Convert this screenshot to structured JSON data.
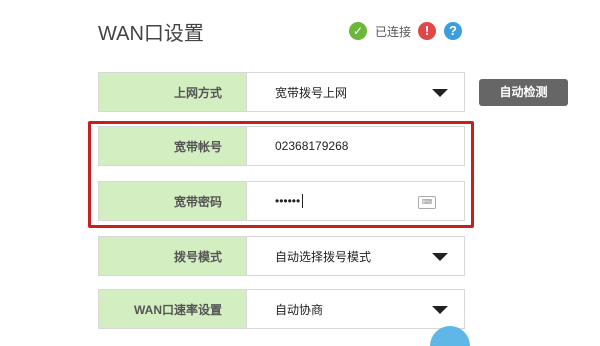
{
  "header": {
    "title": "WAN口设置",
    "status_text": "已连接",
    "status_icon": "check-icon",
    "warning_icon": "exclamation-icon",
    "help_icon": "question-icon",
    "colors": {
      "connected": "#6ab83a",
      "warning": "#e04848",
      "help": "#3c9ddf"
    }
  },
  "form": {
    "connection_type": {
      "label": "上网方式",
      "value": "宽带拨号上网"
    },
    "account": {
      "label": "宽带帐号",
      "value": "02368179268"
    },
    "password": {
      "label": "宽带密码",
      "value": "••••••"
    },
    "dial_mode": {
      "label": "拨号模式",
      "value": "自动选择拨号模式"
    },
    "wan_speed": {
      "label": "WAN口速率设置",
      "value": "自动协商"
    }
  },
  "buttons": {
    "auto_detect": "自动检测"
  },
  "highlight_color": "#c51f1f",
  "label_bg": "#d3eec1"
}
